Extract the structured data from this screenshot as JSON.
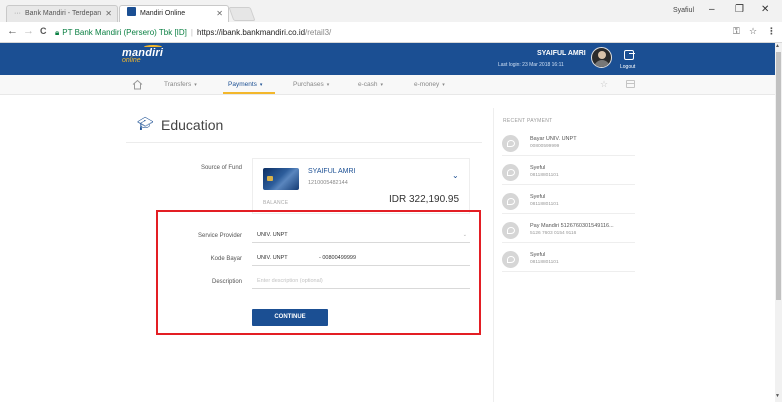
{
  "browser": {
    "tabs": [
      {
        "label": "Bank Mandiri - Terdepan",
        "active": false
      },
      {
        "label": "Mandiri Online",
        "active": true
      }
    ],
    "profile_name": "Syafiul",
    "window_controls": {
      "minimize": "–",
      "maximize": "❐",
      "close": "✕"
    },
    "nav": {
      "back": "←",
      "forward": "→",
      "reload": "C"
    },
    "address": {
      "secure_label": "PT Bank Mandiri (Persero) Tbk [ID]",
      "separator": "|",
      "host": "https://ibank.bankmandiri.co.id",
      "path": "/retail3/"
    }
  },
  "header": {
    "logo_top": "mandiri",
    "logo_bottom": "online",
    "user_name": "SYAIFUL AMRI",
    "last_login": "Last login: 23 Mar 2018 16:11",
    "logout_label": "Logout"
  },
  "nav_menu": {
    "items": [
      {
        "label": "Transfers",
        "active": false
      },
      {
        "label": "Payments",
        "active": true
      },
      {
        "label": "Purchases",
        "active": false
      },
      {
        "label": "e-cash",
        "active": false
      },
      {
        "label": "e-money",
        "active": false
      }
    ]
  },
  "page": {
    "title": "Education",
    "source_of_fund_label": "Source of Fund",
    "source": {
      "name": "SYAIFUL AMRI",
      "account": "1210005482144",
      "balance_label": "BALANCE",
      "balance": "IDR 322,190.95"
    },
    "service_provider_label": "Service Provider",
    "service_provider_value": "UNIV. UNPT",
    "kode_bayar_label": "Kode Bayar",
    "kode_bayar_prefix": "UNIV. UNPT",
    "kode_bayar_value": "- 00800499999",
    "description_label": "Description",
    "description_placeholder": "Enter description (optional)",
    "continue_label": "CONTINUE"
  },
  "recent_payment": {
    "title": "RECENT PAYMENT",
    "items": [
      {
        "name": "Bayar UNIV. UNPT",
        "number": "00800599999"
      },
      {
        "name": "Syeful",
        "number": "08118801101"
      },
      {
        "name": "Syeful",
        "number": "08118801101"
      },
      {
        "name": "Pay Mandiri 5126760301549116...",
        "number": "5126 7603 0154 9116"
      },
      {
        "name": "Syeful",
        "number": "08118801101"
      }
    ]
  },
  "colors": {
    "brand_blue": "#1b4f93",
    "brand_yellow": "#f3b72b",
    "highlight_red": "#e31e24"
  }
}
